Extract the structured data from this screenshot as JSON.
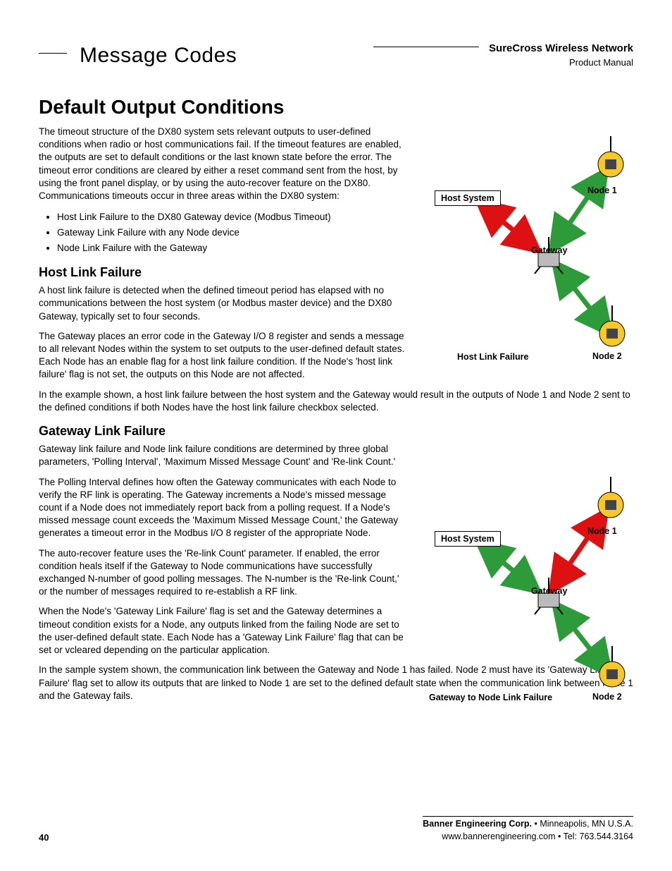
{
  "header": {
    "section": "Message Codes",
    "brand": "SureCross Wireless Network",
    "subtitle": "Product Manual"
  },
  "h1": "Default Output Conditions",
  "intro": "The timeout structure of the DX80 system sets relevant outputs to user-defined conditions when radio or host communications fail. If the timeout features are enabled, the outputs are set to default conditions or the last known state before the error. The timeout error conditions are cleared by either a reset command sent from the host, by using the front panel display, or by using the auto-recover feature on the DX80. Communications timeouts occur in three areas within the DX80 system:",
  "bullets": [
    "Host Link Failure to the DX80 Gateway device (Modbus Timeout)",
    "Gateway Link Failure with any Node device",
    "Node Link Failure with the Gateway"
  ],
  "host": {
    "title": "Host Link Failure",
    "p1": "A host link failure is detected when the defined timeout period has elapsed with no communications between the host system (or Modbus master device) and the DX80 Gateway, typically set to four seconds.",
    "p2": "The Gateway places an error code in the Gateway I/O 8 register and sends a message to all relevant Nodes within the system to set outputs to the user-defined default states. Each Node has an enable flag for a host link failure condition. If the Node's 'host link failure' flag is not set, the outputs on this Node are not affected.",
    "p3": "In the example shown, a host link failure between the host system and the Gateway would result in the outputs of Node 1 and Node 2 sent to the defined conditions if both Nodes have the host link failure checkbox selected."
  },
  "gateway": {
    "title": "Gateway Link Failure",
    "p1": "Gateway link failure and Node link failure conditions are determined by three global parameters, 'Polling Interval', 'Maximum Missed Message Count' and 'Re-link Count.'",
    "p2": "The Polling Interval defines how often the Gateway communicates with each Node to verify the RF link is operating. The Gateway increments a Node's missed message count if a Node does not immediately report back from a polling request. If a Node's missed message count exceeds the 'Maximum Missed Message Count,' the Gateway generates a timeout error in the Modbus I/O 8 register of the appropriate Node.",
    "p3": "The auto-recover feature uses the 'Re-link Count' parameter. If enabled, the error condition heals itself if the Gateway to Node communications have successfully exchanged N-number of good polling messages. The N-number is the 'Re-link Count,' or the number of messages required to re-establish a RF link.",
    "p4": "When the Node's 'Gateway Link Failure' flag is set and the Gateway determines a timeout condition exists for a Node, any outputs linked from the failing Node are set to the user-defined default state. Each Node has a 'Gateway Link Failure' flag that can be set or vcleared depending on the particular application.",
    "p5": "In the sample system shown, the communication link between the Gateway and Node 1 has failed. Node 2 must have its 'Gateway Link Failure' flag set to allow its outputs that are linked to Node 1 are set to the defined default state when the communication link between Node 1 and the Gateway fails."
  },
  "diagram1": {
    "host": "Host System",
    "gateway": "Gateway",
    "node1": "Node 1",
    "node2": "Node 2",
    "caption": "Host Link Failure"
  },
  "diagram2": {
    "host": "Host System",
    "gateway": "Gateway",
    "node1": "Node 1",
    "node2": "Node 2",
    "caption": "Gateway to Node Link Failure"
  },
  "footer": {
    "company": "Banner Engineering Corp.",
    "sep": " • ",
    "loc": "Minneapolis, MN U.S.A.",
    "web": "www.bannerengineering.com  •  Tel: 763.544.3164"
  },
  "page": "40"
}
